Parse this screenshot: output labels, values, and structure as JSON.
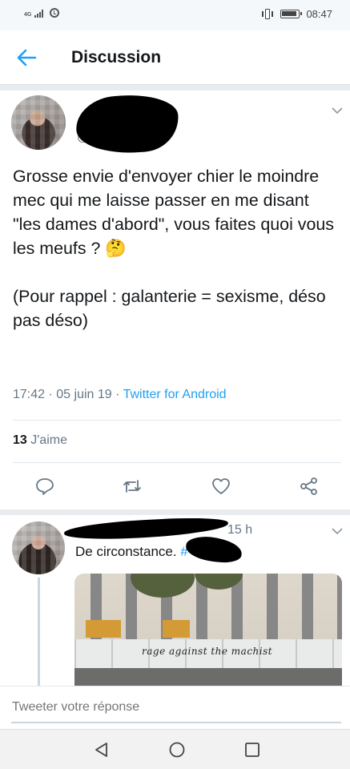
{
  "status_bar": {
    "network": "4G",
    "time": "08:47",
    "icons": [
      "signal-icon",
      "alarm-icon",
      "vibrate-icon",
      "battery-icon"
    ]
  },
  "header": {
    "title": "Discussion",
    "back_icon": "arrow-left-icon"
  },
  "main_tweet": {
    "handle_prefix": "@",
    "text": "Grosse envie d'envoyer chier le moindre mec qui me laisse passer en me disant \"les dames d'abord\", vous faites quoi vous les meufs ? 🤔\n\n(Pour rappel : galanterie = sexisme, déso pas déso)",
    "time": "17:42",
    "date": "05 juin 19",
    "separator": "·",
    "source": "Twitter for Android",
    "likes_count": "13",
    "likes_label": "J'aime",
    "actions": [
      "reply-icon",
      "retweet-icon",
      "like-icon",
      "share-icon"
    ]
  },
  "reply_tweet": {
    "time": "15 h",
    "text": "De circonstance.",
    "hashtag": "#",
    "photo_caption": "rage against the machist"
  },
  "composer": {
    "placeholder": "Tweeter votre réponse"
  },
  "nav_bar": {
    "buttons": [
      "back-triangle-icon",
      "home-circle-icon",
      "recents-square-icon"
    ]
  },
  "colors": {
    "accent": "#1da1f2",
    "text": "#14171a",
    "secondary": "#657786",
    "divider": "#e1e8ed"
  }
}
